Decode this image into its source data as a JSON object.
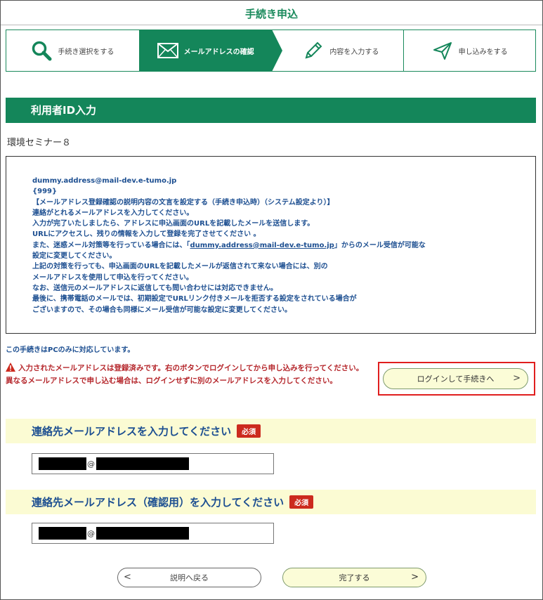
{
  "header": {
    "title": "手続き申込"
  },
  "steps": [
    {
      "label": "手続き選択をする",
      "icon": "search-icon",
      "active": false
    },
    {
      "label": "メールアドレスの確認",
      "icon": "envelope-icon",
      "active": true
    },
    {
      "label": "内容を入力する",
      "icon": "pencil-icon",
      "active": false
    },
    {
      "label": "申し込みをする",
      "icon": "send-icon",
      "active": false
    }
  ],
  "section": {
    "title": "利用者ID入力"
  },
  "seminar": {
    "name": "環境セミナー８"
  },
  "info": {
    "lines": [
      "dummy.address@mail-dev.e-tumo.jp",
      "{999}",
      "【メールアドレス登録確認の説明内容の文言を設定する（手続き申込時）（システム設定より）】",
      "連絡がとれるメールアドレスを入力してください。",
      "入力が完了いたしましたら、アドレスに申込画面のURLを記載したメールを送信します。",
      "URLにアクセスし、残りの情報を入力して登録を完了させてください 。",
      "また、迷惑メール対策等を行っている場合には、「",
      "dummy.address@mail-dev.e-tumo.jp",
      "」からのメール受信が可能な",
      "設定に変更してください。",
      "上記の対策を行っても、申込画面のURLを記載したメールが返信されて来ない場合には、別の",
      "メールアドレスを使用して申込を行ってください。",
      "なお、送信元のメールアドレスに返信しても問い合わせには対応できません。",
      "最後に、携帯電話のメールでは、初期設定でURLリンク付きメールを拒否する設定をされている場合が",
      "ございますので、その場合も同様にメール受信が可能な設定に変更してください。"
    ]
  },
  "notice": {
    "pc_only": "この手続きはPCのみに対応しています。"
  },
  "warning": {
    "icon": "warning-icon",
    "line1": "入力されたメールアドレスは登録済みです。右のボタンでログインしてから申し込みを行ってください。",
    "line2": "異なるメールアドレスで申し込む場合は、ログインせずに別のメールアドレスを入力してください。"
  },
  "login_button": {
    "label": "ログインして手続きへ",
    "chevron": ">"
  },
  "email": {
    "label": "連絡先メールアドレスを入力してください",
    "badge": "必須",
    "at": "@"
  },
  "email_confirm": {
    "label": "連絡先メールアドレス（確認用）を入力してください",
    "badge": "必須",
    "at": "@"
  },
  "footer": {
    "back_label": "説明へ戻る",
    "back_chevron": "<",
    "done_label": "完了する",
    "done_chevron": ">"
  },
  "colors": {
    "brand_green": "#14865a",
    "text_blue": "#1d4f91",
    "warning_red": "#b5262b",
    "badge_red": "#cc2a1e",
    "highlight_yellow": "#fbfbd3",
    "login_outline": "#e01e1e"
  }
}
